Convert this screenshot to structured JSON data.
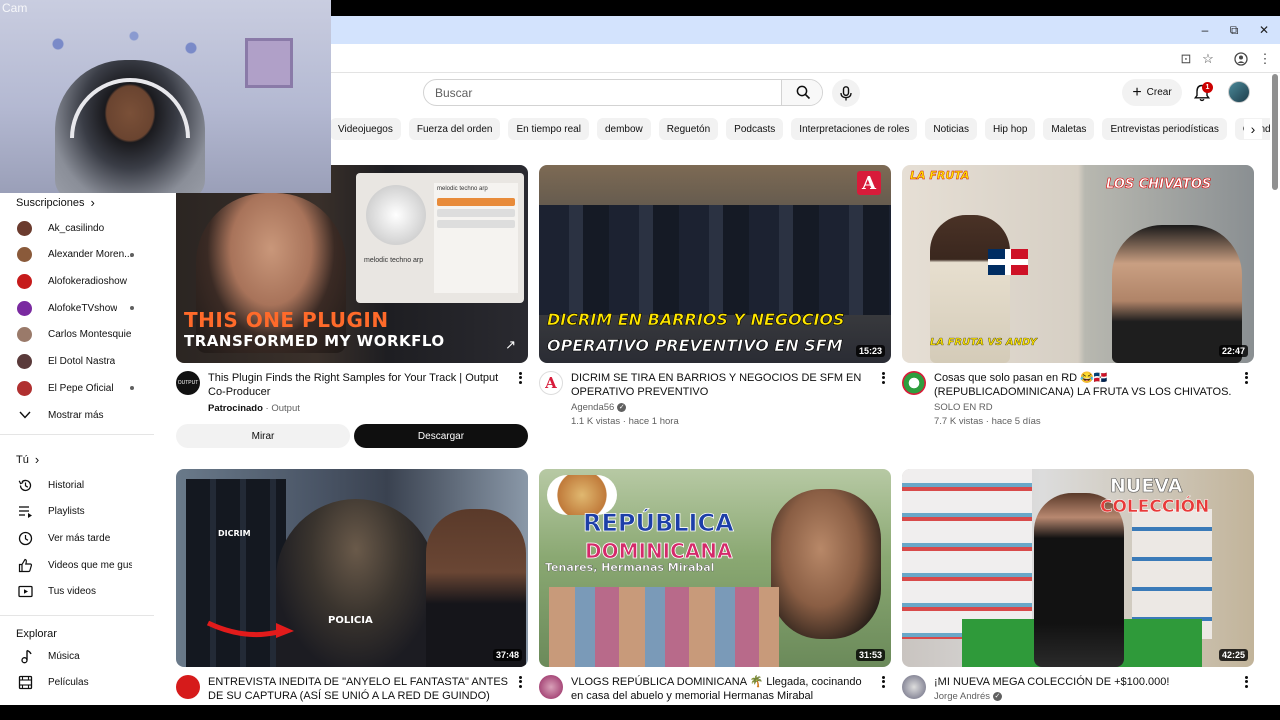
{
  "webcam": {
    "label": "Cam"
  },
  "masthead": {
    "search_placeholder": "Buscar",
    "create_label": "Crear",
    "notifications_count": "1"
  },
  "chips": [
    "Videojuegos",
    "Fuerza del orden",
    "En tiempo real",
    "dembow",
    "Reguetón",
    "Podcasts",
    "Interpretaciones de roles",
    "Noticias",
    "Hip hop",
    "Maletas",
    "Entrevistas periodísticas",
    "Grand Th"
  ],
  "sidebar": {
    "subscriptions_header": "Suscripciones",
    "subscriptions": [
      {
        "label": "Ak_casilindo",
        "color": "#6b3b2e",
        "dot": false
      },
      {
        "label": "Alexander Moren...",
        "color": "#8a5a3a",
        "dot": true
      },
      {
        "label": "Alofokeradioshow",
        "color": "#c61b1b",
        "dot": false
      },
      {
        "label": "AlofokeTVshow",
        "color": "#7a2aa0",
        "dot": true
      },
      {
        "label": "Carlos Montesquieu",
        "color": "#9a7a6a",
        "dot": false
      },
      {
        "label": "El Dotol Nastra",
        "color": "#5a3a3a",
        "dot": false
      },
      {
        "label": "El Pepe Oficial",
        "color": "#b03030",
        "dot": true
      }
    ],
    "show_more": "Mostrar más",
    "you_header": "Tú",
    "you_items": [
      {
        "label": "Historial",
        "icon": "history-icon"
      },
      {
        "label": "Playlists",
        "icon": "playlists-icon"
      },
      {
        "label": "Ver más tarde",
        "icon": "clock-icon"
      },
      {
        "label": "Videos que me gus...",
        "icon": "thumbs-up-icon"
      },
      {
        "label": "Tus videos",
        "icon": "your-videos-icon"
      }
    ],
    "explore_header": "Explorar",
    "explore_items": [
      {
        "label": "Música",
        "icon": "music-note-icon"
      },
      {
        "label": "Películas",
        "icon": "film-icon"
      }
    ]
  },
  "ad": {
    "title": "This Plugin Finds the Right Samples for Your Track | Output Co-Producer",
    "sponsored": "Patrocinado",
    "advertiser": "Output",
    "thumb_line1": "THIS ONE PLUGIN",
    "thumb_line2": "TRANSFORMED MY WORKFLO",
    "thumb_ui_text1": "melodic techno arp",
    "thumb_ui_text2": "melodic techno arp",
    "watch_label": "Mirar",
    "download_label": "Descargar"
  },
  "videos": [
    {
      "title": "DICRIM SE TIRA EN BARRIOS Y NEGOCIOS DE SFM EN OPERATIVO PREVENTIVO",
      "channel": "Agenda56",
      "verified": true,
      "views": "1.1 K vistas",
      "age": "hace 1 hora",
      "duration": "15:23",
      "thumb_line1": "DICRIM EN BARRIOS Y NEGOCIOS",
      "thumb_line2": "OPERATIVO PREVENTIVO EN SFM",
      "thumb_badge": "A",
      "avatar_color": "#d81b3a"
    },
    {
      "title": "Cosas que solo pasan en RD 😂🇩🇴 (REPUBLICADOMINICANA) LA FRUTA VS LOS CHIVATOS.",
      "channel": "SOLO EN RD",
      "verified": false,
      "views": "7.7 K vistas",
      "age": "hace 5 días",
      "duration": "22:47",
      "thumb_line1": "LA FRUTA",
      "thumb_line2": "LOS CHIVATOS",
      "thumb_line3": "LA FRUTA VS ANDY",
      "avatar_color": "#2e9e3e"
    },
    {
      "title": "ENTREVISTA INEDITA DE \"ANYELO EL FANTASTA\" ANTES DE SU CAPTURA (ASÍ SE UNIÓ A LA RED DE GUINDO)",
      "channel": "",
      "duration": "37:48",
      "thumb_text1": "DICRIM",
      "thumb_text2": "POLICIA",
      "avatar_color": "#d61b1b"
    },
    {
      "title": "VLOGS REPÚBLICA DOMINICANA 🌴 Llegada, cocinando en casa del abuelo y memorial Hermanas Mirabal",
      "channel": "",
      "duration": "31:53",
      "thumb_line1": "REPÚBLICA",
      "thumb_line2": "DOMINICANA",
      "thumb_line3": "Tenares, Hermanas Mirabal",
      "avatar_color": "#a84a7a"
    },
    {
      "title": "¡MI NUEVA MEGA COLECCIÓN DE +$100.000!",
      "channel": "Jorge Andrés",
      "verified": true,
      "duration": "42:25",
      "thumb_line1": "NUEVA",
      "thumb_line2": "COLECCIÓN",
      "avatar_color": "#8a8a9a"
    }
  ]
}
